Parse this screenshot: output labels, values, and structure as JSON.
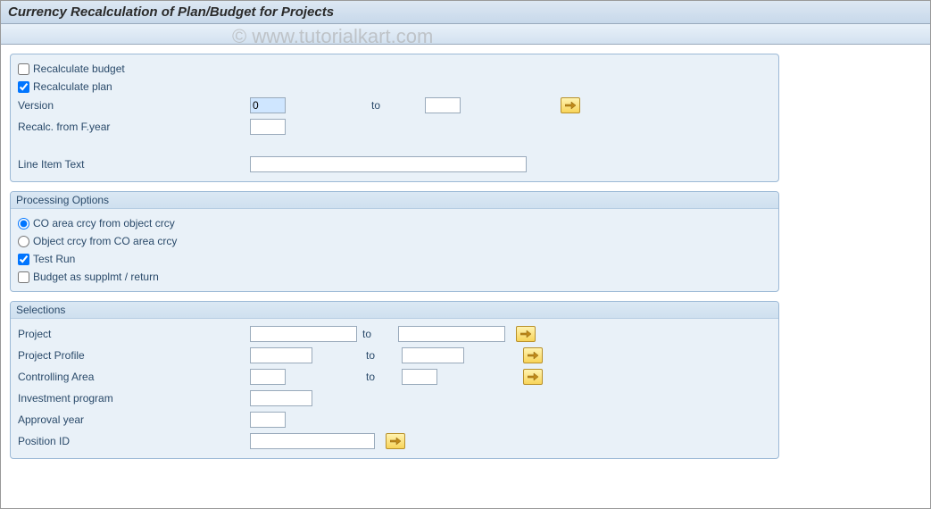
{
  "header": {
    "title": "Currency Recalculation of Plan/Budget for Projects"
  },
  "watermark": "© www.tutorialkart.com",
  "top": {
    "recalc_budget_label": "Recalculate budget",
    "recalc_budget_checked": false,
    "recalc_plan_label": "Recalculate plan",
    "recalc_plan_checked": true,
    "version_label": "Version",
    "version_from": "0",
    "version_to": "",
    "to_text": "to",
    "recalc_year_label": "Recalc. from F.year",
    "recalc_year_value": "",
    "line_item_label": "Line Item Text",
    "line_item_value": ""
  },
  "processing": {
    "title": "Processing Options",
    "opt1_label": "CO area crcy from object crcy",
    "opt2_label": "Object crcy from CO area crcy",
    "selected_option": 1,
    "test_run_label": "Test Run",
    "test_run_checked": true,
    "budget_supp_label": "Budget as supplmt / return",
    "budget_supp_checked": false
  },
  "selections": {
    "title": "Selections",
    "to_text": "to",
    "project_label": "Project",
    "project_from": "",
    "project_to": "",
    "profile_label": "Project Profile",
    "profile_from": "",
    "profile_to": "",
    "ctrl_area_label": "Controlling Area",
    "ctrl_area_from": "",
    "ctrl_area_to": "",
    "invest_label": "Investment program",
    "invest_value": "",
    "approval_label": "Approval year",
    "approval_value": "",
    "position_label": "Position ID",
    "position_value": ""
  }
}
